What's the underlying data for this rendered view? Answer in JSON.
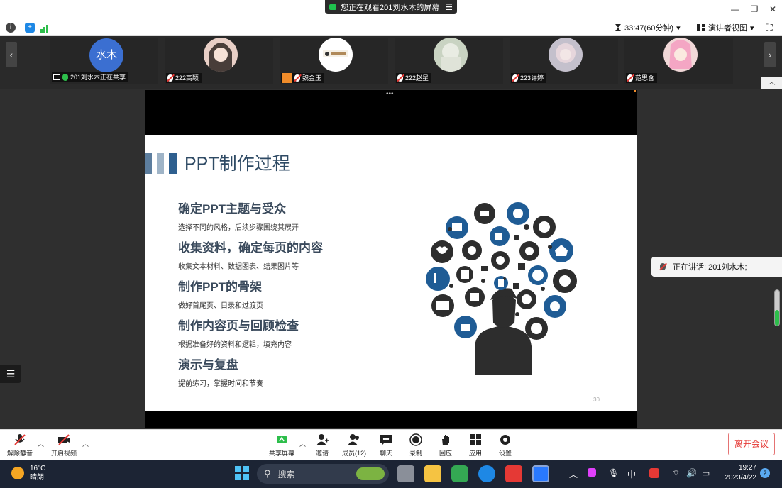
{
  "window": {
    "share_banner": "您正在观看201刘水木的屏幕",
    "menu_glyph": "☰",
    "minimize_glyph": "—",
    "restore_glyph": "❐",
    "close_glyph": "✕"
  },
  "infobar": {
    "timer": "33:47(60分钟)",
    "view_mode": "演讲者视图"
  },
  "participants": [
    {
      "avatar_text": "水木",
      "name": "201刘水木正在共享",
      "mic": "on",
      "avatar_color": "#3b6fd1"
    },
    {
      "avatar_text": "",
      "name": "222高颖",
      "mic": "off",
      "avatar_color": "#e8cfc6"
    },
    {
      "avatar_text": "",
      "name": "魏金玉",
      "mic": "off",
      "avatar_color": "#ffffff"
    },
    {
      "avatar_text": "",
      "name": "222赵星",
      "mic": "off",
      "avatar_color": "#c9d3c2"
    },
    {
      "avatar_text": "",
      "name": "223许婷",
      "mic": "off",
      "avatar_color": "#c4c0cc"
    },
    {
      "avatar_text": "",
      "name": "范思含",
      "mic": "off",
      "avatar_color": "#f1d8d8"
    }
  ],
  "slide": {
    "title": "PPT制作过程",
    "sections": [
      {
        "heading": "确定PPT主题与受众",
        "sub": "选择不同的风格，后续步骤围绕其展开"
      },
      {
        "heading": "收集资料，确定每页的内容",
        "sub": "收集文本材料、数据图表、结果图片等"
      },
      {
        "heading": "制作PPT的骨架",
        "sub": "做好首尾页、目录和过渡页"
      },
      {
        "heading": "制作内容页与回顾检查",
        "sub": "根据准备好的资料和逻辑，填充内容"
      },
      {
        "heading": "演示与复盘",
        "sub": "提前练习，掌握时间和节奏"
      }
    ],
    "page_number": "30",
    "accent_color": "#1e5a8c"
  },
  "speaking": {
    "label": "正在讲话: 201刘水木;"
  },
  "toolbar": {
    "unmute": "解除静音",
    "start_video": "开启视频",
    "share_screen": "共享屏幕",
    "invite": "邀请",
    "members": "成员(12)",
    "chat": "聊天",
    "record": "录制",
    "react": "回应",
    "apps": "应用",
    "settings": "设置",
    "leave": "离开会议"
  },
  "taskbar": {
    "temp": "16°C",
    "weather": "晴朗",
    "search": "搜索",
    "ime": "中",
    "time": "19:27",
    "date": "2023/4/22",
    "notifications": "2"
  }
}
